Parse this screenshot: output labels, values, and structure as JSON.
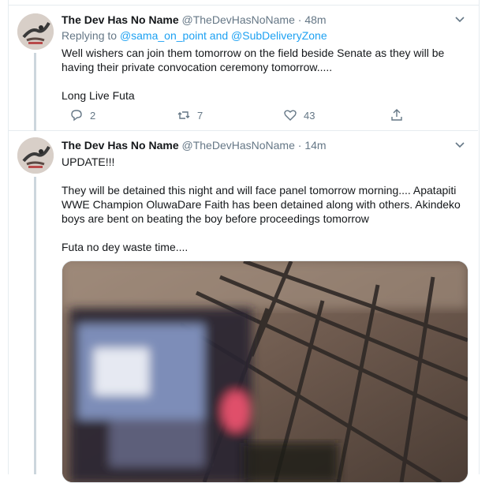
{
  "tweets": [
    {
      "author_name": "The Dev Has No Name",
      "author_handle": "@TheDevHasNoName",
      "separator": "·",
      "time": "48m",
      "replying_prefix": "Replying to",
      "replying_mention_1": "@sama_on_point",
      "replying_and": "and",
      "replying_mention_2": "@SubDeliveryZone",
      "text_line_1": "Well wishers can join them tomorrow on the field beside Senate as they will be",
      "text_line_2": "having their private convocation ceremony tomorrow.....",
      "text_line_3": "Long Live Futa",
      "reply_count": "2",
      "retweet_count": "7",
      "like_count": "43"
    },
    {
      "author_name": "The Dev Has No Name",
      "author_handle": "@TheDevHasNoName",
      "separator": "·",
      "time": "14m",
      "text_update": "UPDATE!!!",
      "text_p1_line1": "They will be detained this night and will face panel tomorrow morning.... Apatapiti",
      "text_p1_line2": "WWE Champion OluwaDare Faith has been detained along with others. Akindeko",
      "text_p1_line3": "boys are bent on beating the boy before proceedings tomorrow",
      "text_p2": "Futa no dey waste time...."
    }
  ],
  "icons": {
    "chevron": "chevron-down-icon",
    "reply": "reply-icon",
    "retweet": "retweet-icon",
    "like": "heart-icon",
    "share": "share-icon"
  },
  "colors": {
    "link": "#1da1f2",
    "secondary": "#657786",
    "border": "#e6ecf0",
    "thread_line": "#ccd6dd"
  }
}
